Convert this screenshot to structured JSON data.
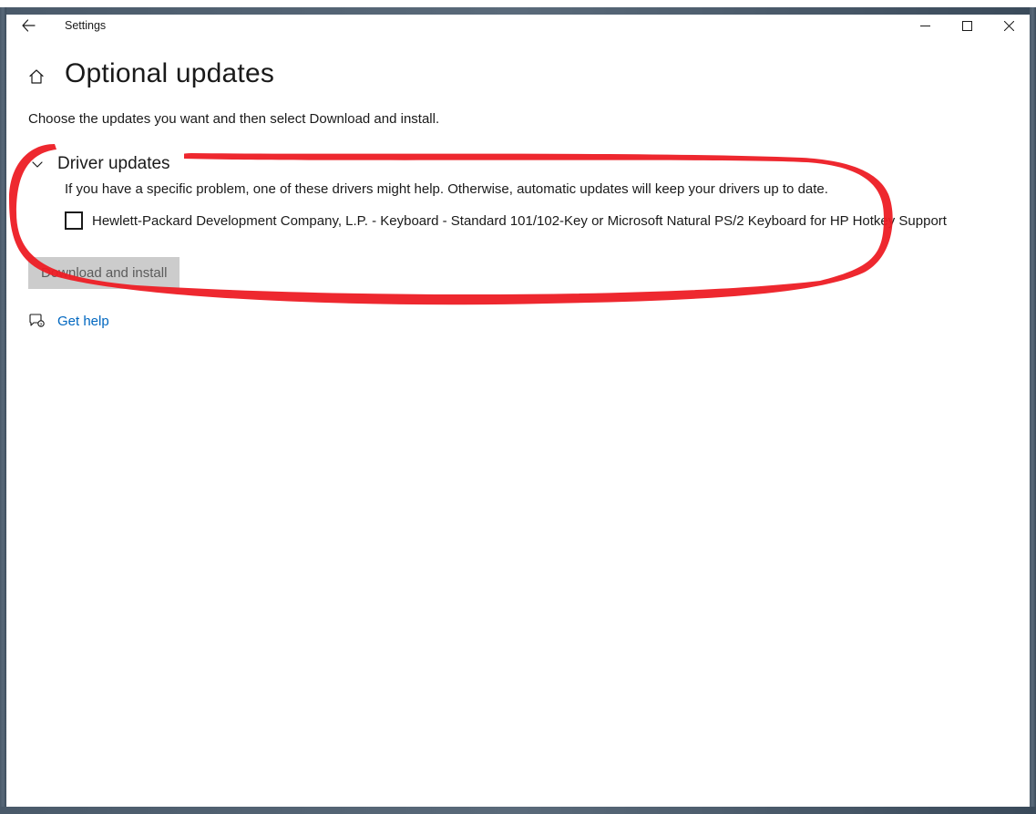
{
  "window": {
    "title": "Settings"
  },
  "page": {
    "title": "Optional updates",
    "instruction": "Choose the updates you want and then select Download and install."
  },
  "section": {
    "title": "Driver updates",
    "description": "If you have a specific problem, one of these drivers might help. Otherwise, automatic updates will keep your drivers up to date."
  },
  "updates": [
    {
      "label": "Hewlett-Packard Development Company, L.P. - Keyboard - Standard 101/102-Key or Microsoft Natural PS/2 Keyboard for HP Hotkey Support",
      "checked": false
    }
  ],
  "actions": {
    "download_install": "Download and install"
  },
  "help": {
    "label": "Get help"
  },
  "colors": {
    "link": "#0067c0",
    "annotation": "#ed1c24"
  }
}
